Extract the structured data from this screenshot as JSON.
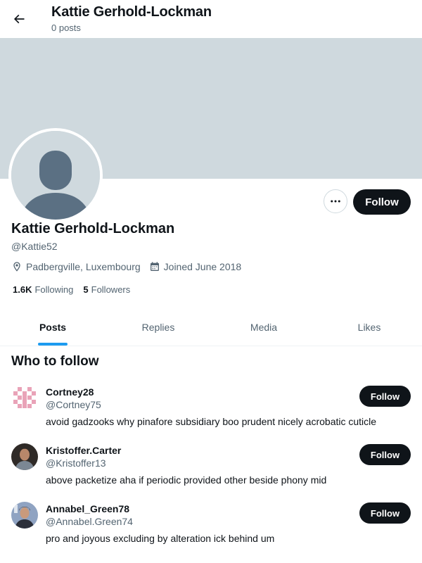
{
  "header": {
    "title": "Kattie Gerhold-Lockman",
    "subtitle": "0 posts"
  },
  "profile": {
    "name": "Kattie Gerhold-Lockman",
    "handle": "@Kattie52",
    "location": "Padbergville, Luxembourg",
    "joined": "Joined June 2018",
    "following_count": "1.6K",
    "following_label": "Following",
    "followers_count": "5",
    "followers_label": "Followers",
    "follow_label": "Follow",
    "banner_color": "#cfd9de"
  },
  "tabs": [
    {
      "label": "Posts",
      "active": true
    },
    {
      "label": "Replies",
      "active": false
    },
    {
      "label": "Media",
      "active": false
    },
    {
      "label": "Likes",
      "active": false
    }
  ],
  "who_to_follow": {
    "title": "Who to follow",
    "suggestions": [
      {
        "name": "Cortney28",
        "handle": "@Cortney75",
        "bio": "avoid gadzooks why pinafore subsidiary boo prudent nicely acrobatic cuticle",
        "follow_label": "Follow"
      },
      {
        "name": "Kristoffer.Carter",
        "handle": "@Kristoffer13",
        "bio": "above packetize aha if periodic provided other beside phony mid",
        "follow_label": "Follow"
      },
      {
        "name": "Annabel_Green78",
        "handle": "@Annabel.Green74",
        "bio": "pro and joyous excluding by alteration ick behind um",
        "follow_label": "Follow"
      }
    ]
  },
  "colors": {
    "accent": "#1d9bf0",
    "text": "#0f1419",
    "muted": "#536471"
  }
}
